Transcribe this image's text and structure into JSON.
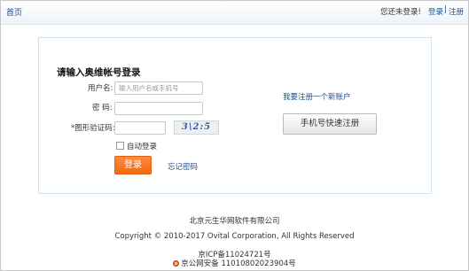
{
  "header": {
    "home": "首页",
    "not_logged_in": "您还未登录!",
    "login": "登录",
    "separator": "|",
    "register": "注册"
  },
  "login_form": {
    "title": "请输入奥维帐号登录",
    "username_label": "用户名:",
    "username_placeholder": "输入用户名或手机号",
    "password_label": "密 码:",
    "captcha_label": "*图形验证码:",
    "captcha_text": "3\\2:5",
    "auto_login": "自动登录",
    "login_button": "登录",
    "forgot_password": "忘记密码"
  },
  "register_side": {
    "new_account": "我要注册一个新账户",
    "mobile_register_button": "手机号快速注册"
  },
  "footer": {
    "company": "北京元生华网软件有限公司",
    "copyright": "Copyright © 2010-2017 Ovital Corporation, All Rights Reserved",
    "icp": "京ICP备11024721号",
    "police": "京公网安备 11010802023904号"
  },
  "colors": {
    "link": "#1a4f96",
    "login_button": "#f06a14",
    "panel_border": "#cfe2f2"
  }
}
